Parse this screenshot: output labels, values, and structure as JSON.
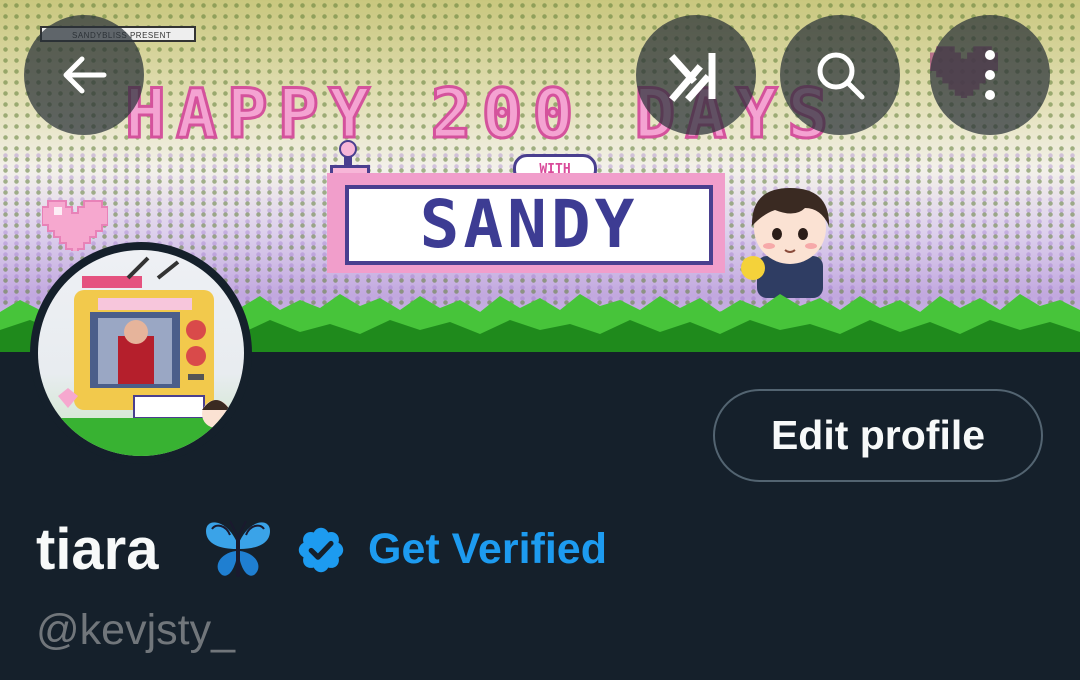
{
  "banner": {
    "presents_text": "SANDYBLISS PRESENT",
    "title": "HAPPY 200 DAYS",
    "with_text": "WITH",
    "name": "SANDY"
  },
  "toolbar": {
    "back_icon": "arrow-left-icon",
    "grok_icon": "grok-icon",
    "search_icon": "search-icon",
    "more_icon": "more-vertical-icon"
  },
  "profile": {
    "display_name": "tiara",
    "emoji": "butterfly",
    "verified_label": "Get Verified",
    "handle": "@kevjsty_",
    "edit_label": "Edit profile"
  },
  "colors": {
    "background": "#15202b",
    "accent": "#1d9bf0",
    "text_primary": "#f7f9f9",
    "text_secondary": "#71767b",
    "button_border": "#536471"
  }
}
